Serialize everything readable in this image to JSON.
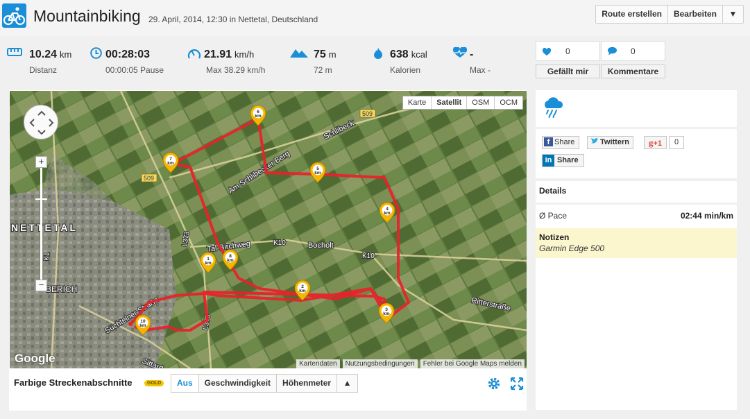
{
  "header": {
    "title": "Mountainbiking",
    "subtitle": "29. April, 2014, 12:30 in Nettetal, Deutschland",
    "buttons": [
      "Route erstellen",
      "Bearbeiten",
      "▼"
    ]
  },
  "stats": [
    {
      "icon": "ruler-icon",
      "value": "10.24",
      "unit": "km",
      "sub": "Distanz"
    },
    {
      "icon": "clock-icon",
      "value": "00:28:03",
      "unit": "",
      "sub": "00:00:05 Pause"
    },
    {
      "icon": "speedometer-icon",
      "value": "21.91",
      "unit": "km/h",
      "sub": "Max 38.29 km/h"
    },
    {
      "icon": "mountain-icon",
      "value": "75",
      "unit": "m",
      "sub": "72 m"
    },
    {
      "icon": "flame-icon",
      "value": "638",
      "unit": "kcal",
      "sub": "Kalorien"
    },
    {
      "icon": "heart-rate-icon",
      "value": "-",
      "unit": "",
      "sub": "Max -"
    }
  ],
  "social": {
    "likes_count": "0",
    "comments_count": "0",
    "like_label": "Gefällt mir",
    "comment_label": "Kommentare"
  },
  "map": {
    "types": [
      "Karte",
      "Satellit",
      "OSM",
      "OCM"
    ],
    "active_type": "Satellit",
    "footer": [
      "Kartendaten",
      "Nutzungsbedingungen",
      "Fehler bei Google Maps melden"
    ],
    "google_label": "Google",
    "place_labels": [
      "NETTETAL",
      "BERICH",
      "Schlibeck",
      "Am Schlibecker Berg",
      "Tal-Birchweg",
      "Bocholt",
      "K10",
      "K10",
      "K1",
      "L373",
      "L373",
      "509",
      "509",
      "Süchtelner Straße",
      "Sittard",
      "Ritterstraße"
    ],
    "markers": [
      "1",
      "2",
      "3",
      "4",
      "5",
      "6",
      "7",
      "8",
      "10"
    ],
    "marker_unit": "km",
    "route_color": "#e8232a"
  },
  "legend": {
    "label": "Farbige Streckenabschnitte",
    "badge": "GOLD",
    "segments": [
      "Aus",
      "Geschwindigkeit",
      "Höhenmeter",
      "▲"
    ],
    "active": "Aus"
  },
  "share": {
    "facebook": "Share",
    "twitter": "Twittern",
    "gplus": "+1",
    "gplus_count": "0",
    "linkedin": "Share"
  },
  "details": {
    "heading": "Details",
    "pace_label": "Ø Pace",
    "pace_value": "02:44 min/km",
    "notes_heading": "Notizen",
    "notes_text": "Garmin Edge 500"
  },
  "colors": {
    "accent": "#1a8ed6",
    "route": "#e8232a",
    "marker": "#f6b600",
    "notes_bg": "#fcf6cf"
  }
}
